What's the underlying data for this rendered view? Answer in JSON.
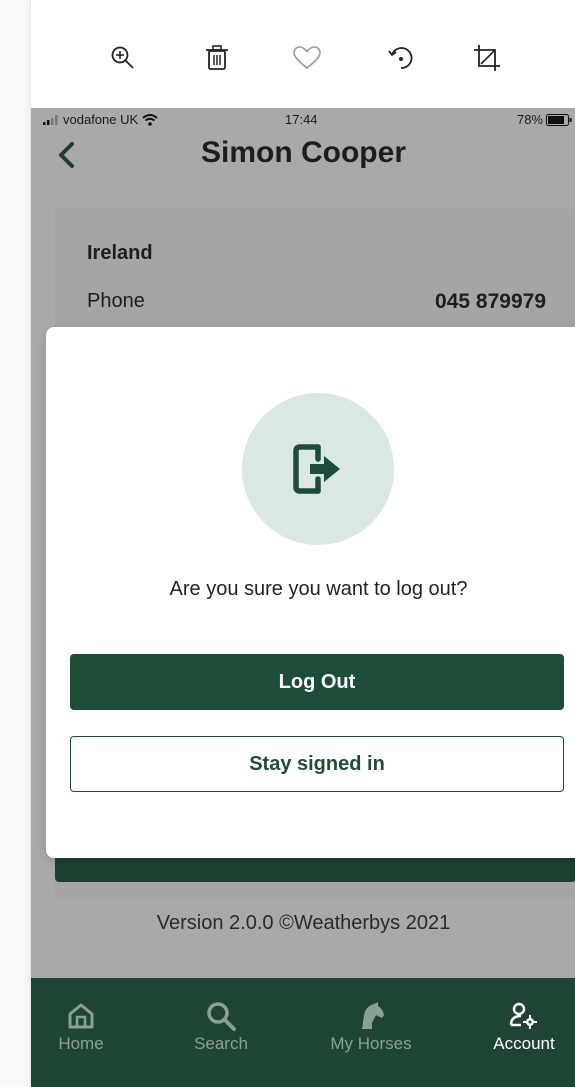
{
  "toolbar": {
    "icons": [
      "zoom-in-icon",
      "trash-icon",
      "heart-icon",
      "rotate-icon",
      "crop-icon"
    ]
  },
  "status_bar": {
    "carrier": "vodafone UK",
    "time": "17:44",
    "battery": "78%"
  },
  "header": {
    "title": "Simon Cooper"
  },
  "contact": {
    "country": "Ireland",
    "phone_label": "Phone",
    "phone_value": "045 879979"
  },
  "footer": {
    "version": "Version 2.0.0 ©Weatherbys 2021"
  },
  "dialog": {
    "question": "Are you sure you want to log out?",
    "confirm_label": "Log Out",
    "cancel_label": "Stay signed in"
  },
  "tabs": [
    {
      "label": "Home",
      "icon": "home-icon"
    },
    {
      "label": "Search",
      "icon": "search-icon"
    },
    {
      "label": "My Horses",
      "icon": "horse-icon"
    },
    {
      "label": "Account",
      "icon": "account-settings-icon"
    }
  ],
  "colors": {
    "brand_green": "#1d4d38",
    "tabbar": "#1e4434",
    "icon_bg": "#d9e8e3"
  }
}
